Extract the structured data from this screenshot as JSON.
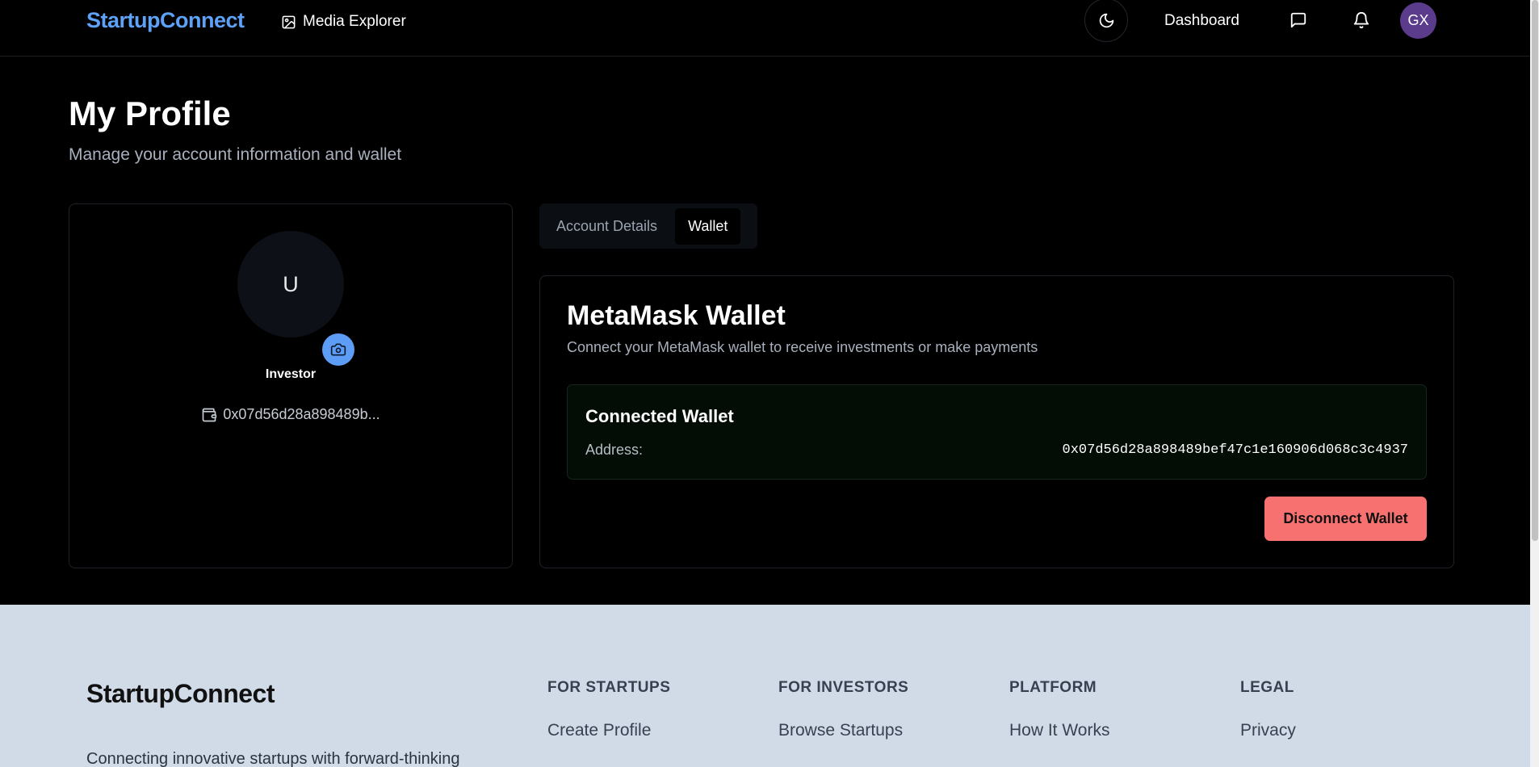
{
  "header": {
    "brand": "StartupConnect",
    "media_label": "Media Explorer",
    "dashboard_label": "Dashboard",
    "avatar_initials": "GX"
  },
  "page": {
    "title": "My Profile",
    "subtitle": "Manage your account information and wallet"
  },
  "profile": {
    "avatar_letter": "U",
    "role": "Investor",
    "wallet_short": "0x07d56d28a898489b..."
  },
  "tabs": [
    {
      "label": "Account Details",
      "active": false
    },
    {
      "label": "Wallet",
      "active": true
    }
  ],
  "wallet": {
    "title": "MetaMask Wallet",
    "description": "Connect your MetaMask wallet to receive investments or make payments",
    "connected_title": "Connected Wallet",
    "address_label": "Address:",
    "address": "0x07d56d28a898489bef47c1e160906d068c3c4937",
    "disconnect_label": "Disconnect Wallet"
  },
  "footer": {
    "brand": "StartupConnect",
    "tagline": "Connecting innovative startups with forward-thinking",
    "columns": [
      {
        "heading": "FOR STARTUPS",
        "link": "Create Profile"
      },
      {
        "heading": "FOR INVESTORS",
        "link": "Browse Startups"
      },
      {
        "heading": "PLATFORM",
        "link": "How It Works"
      },
      {
        "heading": "LEGAL",
        "link": "Privacy"
      }
    ]
  },
  "colors": {
    "brand_blue": "#5ea2f7",
    "disconnect_red": "#f87171",
    "avatar_purple": "#5a3b8c"
  }
}
